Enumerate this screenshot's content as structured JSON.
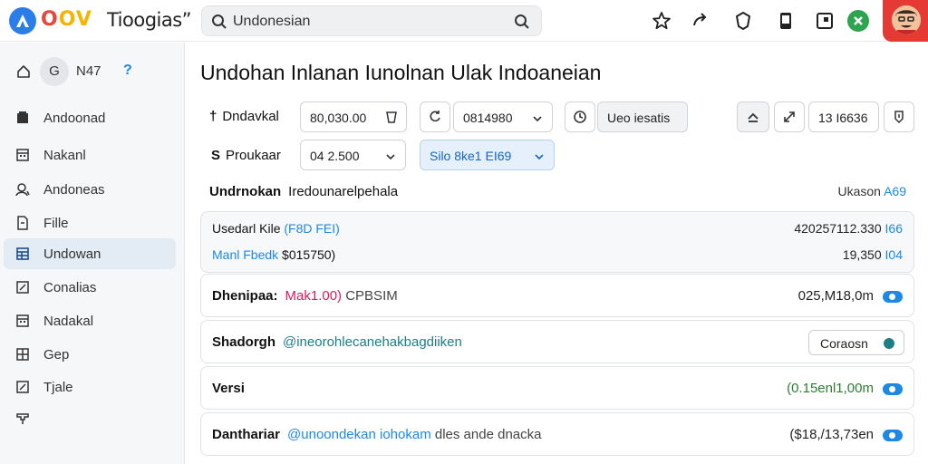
{
  "brand": {
    "word": [
      "O",
      "O",
      "V"
    ],
    "name": "Tioogias”"
  },
  "search": {
    "value": "Undonesian"
  },
  "sidebar": {
    "head_icon_letter": "G",
    "head_label": "N47",
    "help": "?",
    "items": [
      {
        "label": "Andoonad",
        "icon": "note-icon"
      },
      {
        "label": "Nakanl",
        "icon": "calendar-icon"
      },
      {
        "label": "Andoneas",
        "icon": "person-icon"
      },
      {
        "label": "Fille",
        "icon": "file-icon"
      },
      {
        "label": "Undowan",
        "icon": "grid-icon",
        "active": true
      },
      {
        "label": "Conalias",
        "icon": "edit-icon"
      },
      {
        "label": "Nadakal",
        "icon": "calendar-icon"
      },
      {
        "label": "Gep",
        "icon": "table-icon"
      },
      {
        "label": "Tjale",
        "icon": "edit-icon"
      },
      {
        "label": "",
        "icon": "flag-icon"
      }
    ]
  },
  "main": {
    "title": "Undohan Inlanan Iunolnan Ulak Indoaneian",
    "row1": {
      "prefix": "†",
      "label": "Dndavkal",
      "value": "80,030.00",
      "select1": "0814980",
      "search_value": "Ueo iesatis",
      "right_value": "13 I6636"
    },
    "row2": {
      "prefix": "S",
      "label": "Proukaar",
      "select1": "04 2.500",
      "select2": "Silo 8ke1 EI69"
    },
    "info": {
      "left_bold": "Undrnokan",
      "left_text": "Iredounarelpehala",
      "right_text": "Ukason",
      "right_accent": "A69"
    },
    "summary": {
      "line1_label": "Usedarl Kile",
      "line1_accent": "(F8D FEI)",
      "line1_right": "420257112.330",
      "line1_right_accent": "I66",
      "line2_label": "Manl Fbedk",
      "line2_value": "$015750)",
      "line2_right": "19,350",
      "line2_right_accent": "I04"
    },
    "rows": [
      {
        "label": "Dhenipaa:",
        "accent": "Mak1.00)",
        "text": "CPBSIM",
        "right": "025,M18,0m",
        "control": "toggle"
      },
      {
        "label": "Shadorgh",
        "accent": "@ineorohlecanehakbagdiiken",
        "text": "",
        "right": "",
        "control": "button",
        "button_label": "Coraosn"
      },
      {
        "label": "Versi",
        "accent": "",
        "text": "",
        "right": "(0.15enl1,00m",
        "control": "toggle"
      },
      {
        "label": "Danthariar",
        "accent": "@unoondekan iohokam",
        "text": "dles ande dnacka",
        "right": "($18,/13,73en",
        "control": "toggle"
      }
    ]
  },
  "colors": {
    "accent": "#1e88e5",
    "magenta": "#d81b60",
    "green": "#2e7d32",
    "brand_red": "#e53935"
  }
}
